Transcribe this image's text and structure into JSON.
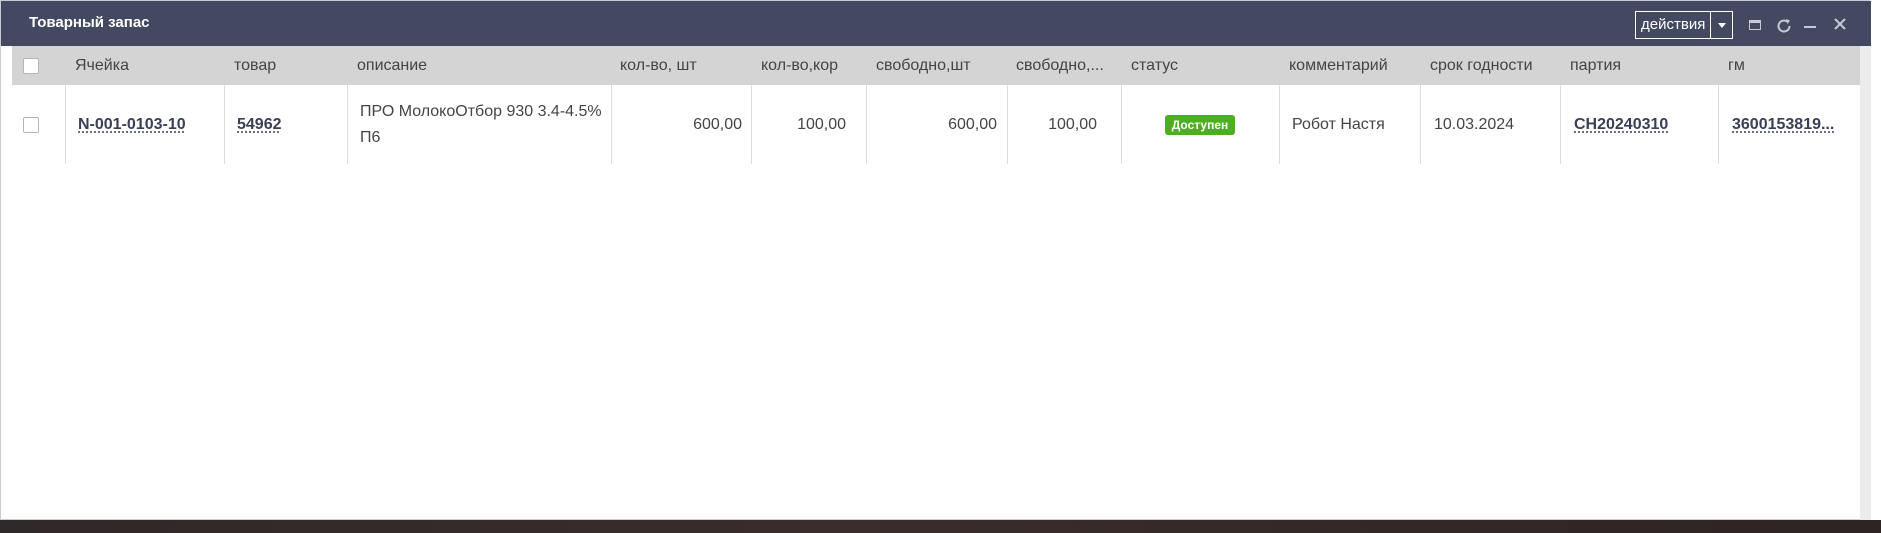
{
  "window": {
    "title": "Товарный запас",
    "actions_label": "действия",
    "tools": [
      "maximize-icon",
      "refresh-icon",
      "minimize-icon",
      "close-icon"
    ]
  },
  "table": {
    "columns": [
      "Ячейка",
      "товар",
      "описание",
      "кол-во, шт",
      "кол-во,кор",
      "свободно,шт",
      "свободно,...",
      "статус",
      "комментарий",
      "срок годности",
      "партия",
      "гм"
    ],
    "rows": [
      {
        "cell": "N-001-0103-10",
        "item": "54962",
        "description": "ПРО МолокоОтбор 930 3.4-4.5% П6",
        "qty_pcs": "600,00",
        "qty_boxes": "100,00",
        "free_pcs": "600,00",
        "free_boxes": "100,00",
        "status": "Доступен",
        "comment": "Робот Настя",
        "expiry": "10.03.2024",
        "batch": "CH20240310",
        "gm": "3600153819..."
      }
    ]
  },
  "colors": {
    "titlebar": "#434961",
    "header": "#d4d4d4",
    "status_ok": "#4caf1f"
  }
}
